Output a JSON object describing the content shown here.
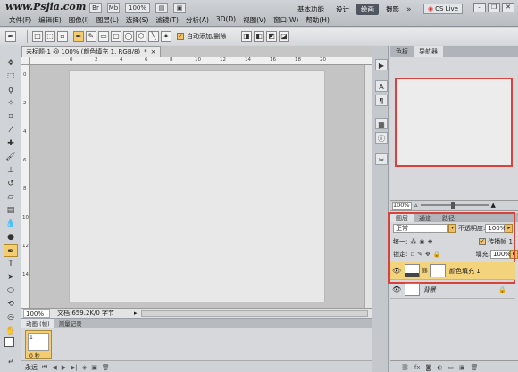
{
  "watermark": "www.Psjia.com",
  "menu": [
    "文件(F)",
    "编辑(E)",
    "图像(I)",
    "图层(L)",
    "选择(S)",
    "滤镜(T)",
    "分析(A)",
    "3D(D)",
    "视图(V)",
    "窗口(W)",
    "帮助(H)"
  ],
  "top_zoom": "100%",
  "workspaces": [
    "基本功能",
    "设计",
    "绘画",
    "摄影"
  ],
  "active_workspace": "绘画",
  "workspace_more": "»",
  "cs_live": "CS Live",
  "options": {
    "auto_add_delete": "自动添加/删除"
  },
  "document": {
    "tab_title": "未标题-1 @ 100% (颜色填充 1, RGB/8)",
    "tab_modified": "*",
    "ruler_top": [
      "0",
      "2",
      "4",
      "6",
      "8",
      "10",
      "12",
      "14",
      "16",
      "18",
      "20"
    ],
    "ruler_left": [
      "0",
      "2",
      "4",
      "6",
      "8",
      "10",
      "12",
      "14"
    ],
    "zoom": "100%",
    "info": "文档:659.2K/0 字节"
  },
  "animation": {
    "tabs": [
      "动画 (帧)",
      "测量记录"
    ],
    "frame_number": "1",
    "frame_delay": "0 秒",
    "loop": "永远"
  },
  "navigator": {
    "tabs": [
      "色板",
      "导航器"
    ],
    "zoom": "100%"
  },
  "layers": {
    "tabs": [
      "图层",
      "通道",
      "路径"
    ],
    "blend_mode": "正常",
    "opacity_label": "不透明度:",
    "opacity": "100%",
    "unify_label": "统一:",
    "propagate_label": "传播帧 1",
    "lock_label": "锁定:",
    "fill_label": "填充:",
    "fill": "100%",
    "items": [
      {
        "name": "颜色填充 1",
        "selected": true
      },
      {
        "name": "背景",
        "selected": false,
        "locked": true
      }
    ]
  },
  "colors": {
    "accent": "#f3cd6f",
    "highlight_border": "#d7433c"
  }
}
